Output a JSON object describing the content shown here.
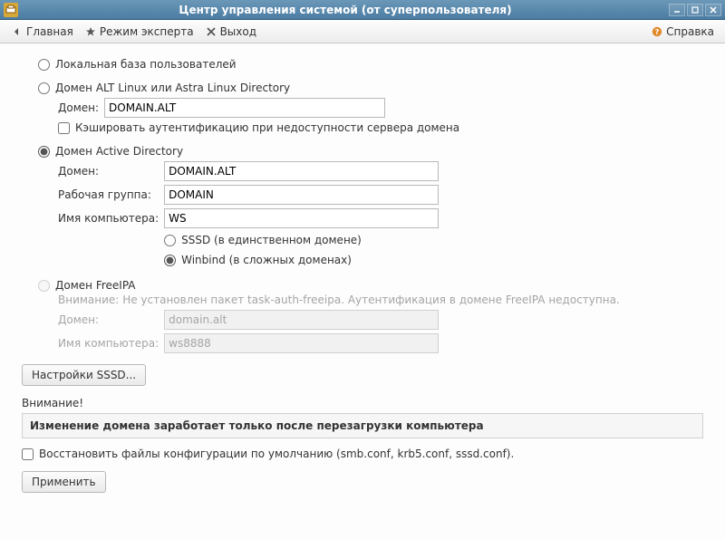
{
  "window": {
    "title": "Центр управления системой (от суперпользователя)"
  },
  "toolbar": {
    "home": "Главная",
    "expert": "Режим эксперта",
    "exit": "Выход",
    "help": "Справка"
  },
  "auth": {
    "local": {
      "label": "Локальная база пользователей"
    },
    "alt": {
      "label": "Домен ALT Linux или Astra Linux Directory",
      "domain_label": "Домен:",
      "domain_value": "DOMAIN.ALT",
      "cache_label": "Кэшировать аутентификацию при недоступности сервера домена"
    },
    "ad": {
      "label": "Домен Active Directory",
      "domain_label": "Домен:",
      "domain_value": "DOMAIN.ALT",
      "workgroup_label": "Рабочая группа:",
      "workgroup_value": "DOMAIN",
      "computer_label": "Имя компьютера:",
      "computer_value": "WS",
      "sssd_label": "SSSD (в единственном домене)",
      "winbind_label": "Winbind (в сложных доменах)"
    },
    "freeipa": {
      "label": "Домен FreeIPA",
      "warning_label": "Внимание:",
      "warning_text": "Не установлен пакет task-auth-freeipa. Аутентификация в домене FreeIPA недоступна.",
      "domain_label": "Домен:",
      "domain_placeholder": "domain.alt",
      "computer_label": "Имя компьютера:",
      "computer_placeholder": "ws8888"
    }
  },
  "buttons": {
    "sssd_settings": "Настройки SSSD...",
    "apply": "Применить"
  },
  "notice": {
    "heading": "Внимание!",
    "text": "Изменение домена заработает только после перезагрузки компьютера"
  },
  "restore": {
    "label": "Восстановить файлы конфигурации по умолчанию (smb.conf, krb5.conf, sssd.conf)."
  }
}
